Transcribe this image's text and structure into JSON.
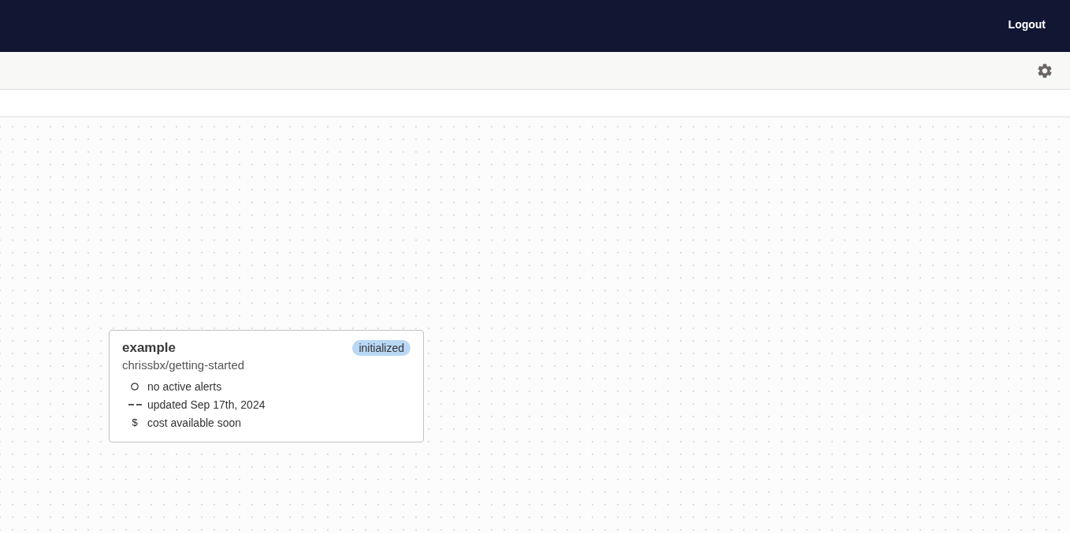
{
  "header": {
    "logout": "Logout"
  },
  "canvas": {
    "nodes": [
      {
        "title": "example",
        "status": "initialized",
        "repo": "chrissbx/getting-started",
        "lines": [
          {
            "kind": "circle",
            "text": "no active alerts"
          },
          {
            "kind": "dashes",
            "text": "updated Sep 17th, 2024"
          },
          {
            "kind": "glyph",
            "glyph": "$",
            "text": "cost available soon"
          }
        ]
      }
    ]
  }
}
